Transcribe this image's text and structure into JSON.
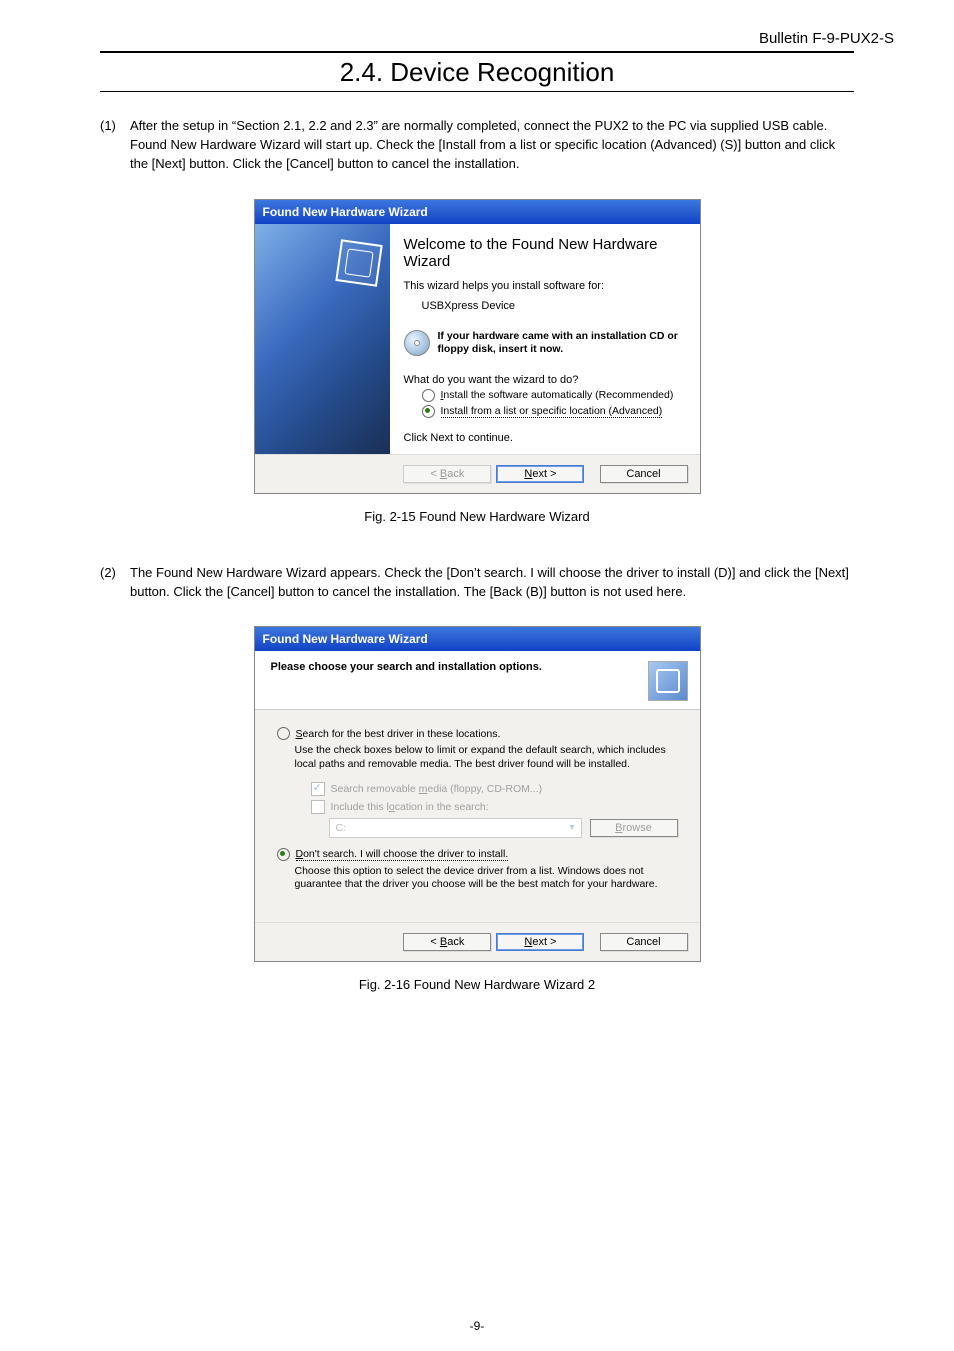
{
  "header": {
    "bulletin": "Bulletin F-9-PUX2-S"
  },
  "section_title": "2.4. Device Recognition",
  "item1": {
    "num": "(1)",
    "text": "After the setup in “Section 2.1, 2.2 and 2.3” are normally completed, connect the PUX2 to the PC via supplied USB cable. Found New Hardware Wizard will start up. Check the [Install from a list or specific location (Advanced) (S)] button and click the [Next] button. Click the [Cancel] button to cancel the installation."
  },
  "wizard1": {
    "title": "Found New Hardware Wizard",
    "heading": "Welcome to the Found New Hardware Wizard",
    "sub": "This wizard helps you install software for:",
    "device": "USBXpress Device",
    "cd_text": "If your hardware came with an installation CD or floppy disk, insert it now.",
    "question": "What do you want the wizard to do?",
    "opt_auto_pre": "I",
    "opt_auto": "nstall the software automatically (Recommended)",
    "opt_list": "Install from a list or specific location (Advanced)",
    "continue": "Click Next to continue.",
    "back_pre": "< ",
    "back_u": "B",
    "back_post": "ack",
    "next_u": "N",
    "next_post": "ext >",
    "cancel": "Cancel"
  },
  "fig1": "Fig. 2-15   Found New Hardware Wizard",
  "item2": {
    "num": "(2)",
    "text": "The Found New Hardware Wizard appears. Check the [Don’t search. I will choose the driver to install (D)] and click the [Next] button. Click the [Cancel] button to cancel the installation. The [Back (B)] button is not used here."
  },
  "wizard2": {
    "title": "Found New Hardware Wizard",
    "header": "Please choose your search and installation options.",
    "opt_search_u": "S",
    "opt_search": "earch for the best driver in these locations.",
    "desc_search": "Use the check boxes below to limit or expand the default search, which includes local paths and removable media. The best driver found will be installed.",
    "chk_media_pre": "Search removable ",
    "chk_media_u": "m",
    "chk_media_post": "edia (floppy, CD-ROM...)",
    "chk_loc_pre": "Include this l",
    "chk_loc_u": "o",
    "chk_loc_post": "cation in the search:",
    "path": "C:",
    "browse_u": "B",
    "browse_post": "rowse",
    "opt_dont_u": "D",
    "opt_dont": "on't search. I will choose the driver to install.",
    "desc_dont": "Choose this option to select the device driver from a list.  Windows does not guarantee that the driver you choose will be the best match for your hardware.",
    "back_pre": "< ",
    "back_u": "B",
    "back_post": "ack",
    "next_u": "N",
    "next_post": "ext >",
    "cancel": "Cancel"
  },
  "fig2": "Fig. 2-16 Found New Hardware Wizard 2",
  "page_number": "-9-"
}
